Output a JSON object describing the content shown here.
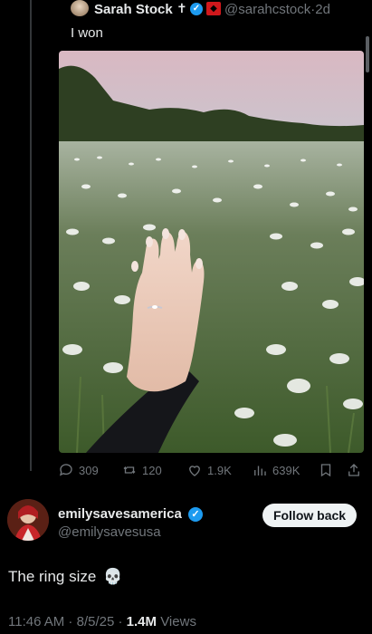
{
  "quoted_post": {
    "author_name": "Sarah Stock",
    "name_emoji": "✝",
    "handle": "@sarahcstock",
    "separator": "·",
    "time": "2d",
    "text": "I won"
  },
  "actions": {
    "replies": "309",
    "reposts": "120",
    "likes": "1.9K",
    "views": "639K"
  },
  "post": {
    "author_name": "emilysavesamerica",
    "handle": "@emilysavesusa",
    "follow_label": "Follow back",
    "text": "The ring size",
    "emoji": "💀",
    "time": "11:46 AM",
    "date": "8/5/25",
    "view_count": "1.4M",
    "views_label": "Views"
  },
  "colors": {
    "background": "#000000",
    "accent": "#1d9bf0",
    "text": "#e7e9ea",
    "muted": "#71767b"
  }
}
